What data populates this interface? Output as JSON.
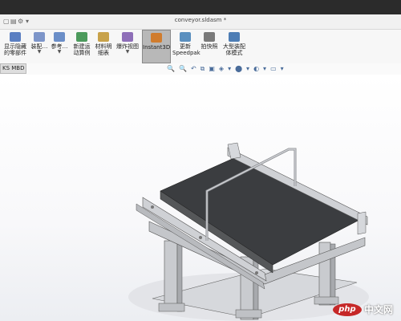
{
  "window": {
    "title": "conveyor.sldasm *"
  },
  "ribbon": {
    "buttons": [
      {
        "label": "显示隐藏\n的零部件",
        "icon": "show-hide-components-icon",
        "color": "#5b7fc2"
      },
      {
        "label": "装配…",
        "icon": "assembly-features-icon",
        "color": "#7d95c9",
        "dropdown": "▼"
      },
      {
        "label": "参考…",
        "icon": "reference-geometry-icon",
        "color": "#6b8ec8",
        "dropdown": "▼"
      },
      {
        "label": "新建运\n动算例",
        "icon": "new-motion-study-icon",
        "color": "#4c9a5c"
      },
      {
        "label": "材料明\n细表",
        "icon": "bill-of-materials-icon",
        "color": "#c8a24a"
      },
      {
        "label": "爆炸视图",
        "icon": "exploded-view-icon",
        "color": "#8e6fb8",
        "dropdown": "▼"
      },
      {
        "label": "Instant3D",
        "icon": "instant3d-icon",
        "color": "#d07c2e",
        "active": true
      },
      {
        "label": "更新\nSpeedpak",
        "icon": "speedpak-icon",
        "color": "#5a8fbf"
      },
      {
        "label": "拍快照",
        "icon": "snapshot-icon",
        "color": "#7a7a7a"
      },
      {
        "label": "大型装配\n体模式",
        "icon": "large-assembly-icon",
        "color": "#4d7db5"
      }
    ]
  },
  "tabs": [
    {
      "label": "KS MBD"
    }
  ],
  "view_tools": [
    "🔍",
    "🔍",
    "↶",
    "⧉",
    "▣",
    "◈",
    "▾",
    "⬤",
    "▾",
    "◐",
    "▾",
    "▭",
    "▾"
  ],
  "watermark": {
    "logo": "php",
    "text": "中文网"
  }
}
